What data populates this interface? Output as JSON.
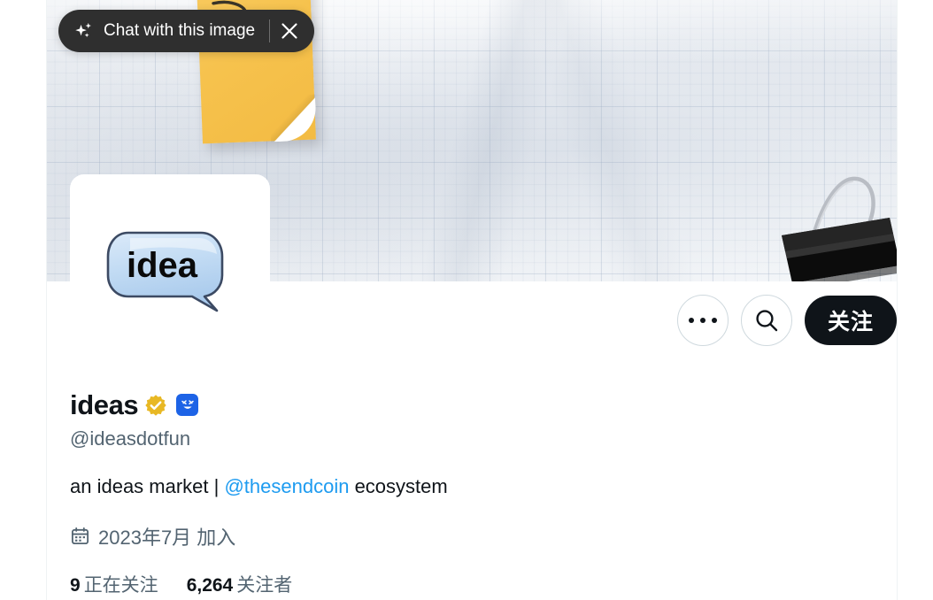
{
  "overlay": {
    "chat_pill": {
      "label": "Chat with this image",
      "spark_icon": "sparkle-icon",
      "close_icon": "close-icon",
      "background": "#2f2f2f"
    }
  },
  "banner": {
    "alt": "graph paper with yellow sticky note and black binder clip",
    "sticky_note_color": "#f6c24d",
    "binder_clip_color": "#0a0a0a",
    "paper_color": "#eef1f5"
  },
  "avatar": {
    "alt": "speech bubble logo",
    "bubble_text": "idea",
    "bubble_color": "#bcd9f5",
    "background": "#ffffff"
  },
  "actions": {
    "more_icon": "more-horizontal-icon",
    "more_label": "",
    "search_icon": "search-icon",
    "search_label": "",
    "follow_label": "关注",
    "follow_bg": "#0f1419",
    "follow_fg": "#ffffff"
  },
  "profile": {
    "display_name": "ideas",
    "verified_badge": "verified-gold-badge",
    "affiliate_badge": "affiliate-badge",
    "affiliate_badge_color": "#1d63e6",
    "handle": "@ideasdotfun",
    "bio": {
      "prefix": "an ideas market | ",
      "mention": "@thesendcoin",
      "suffix": " ecosystem",
      "link_color": "#1d9bf0"
    },
    "joined": {
      "icon": "calendar-icon",
      "text": "2023年7月 加入"
    },
    "stats": [
      {
        "count": "9",
        "label": "正在关注"
      },
      {
        "count": "6,264",
        "label": "关注者"
      }
    ]
  }
}
